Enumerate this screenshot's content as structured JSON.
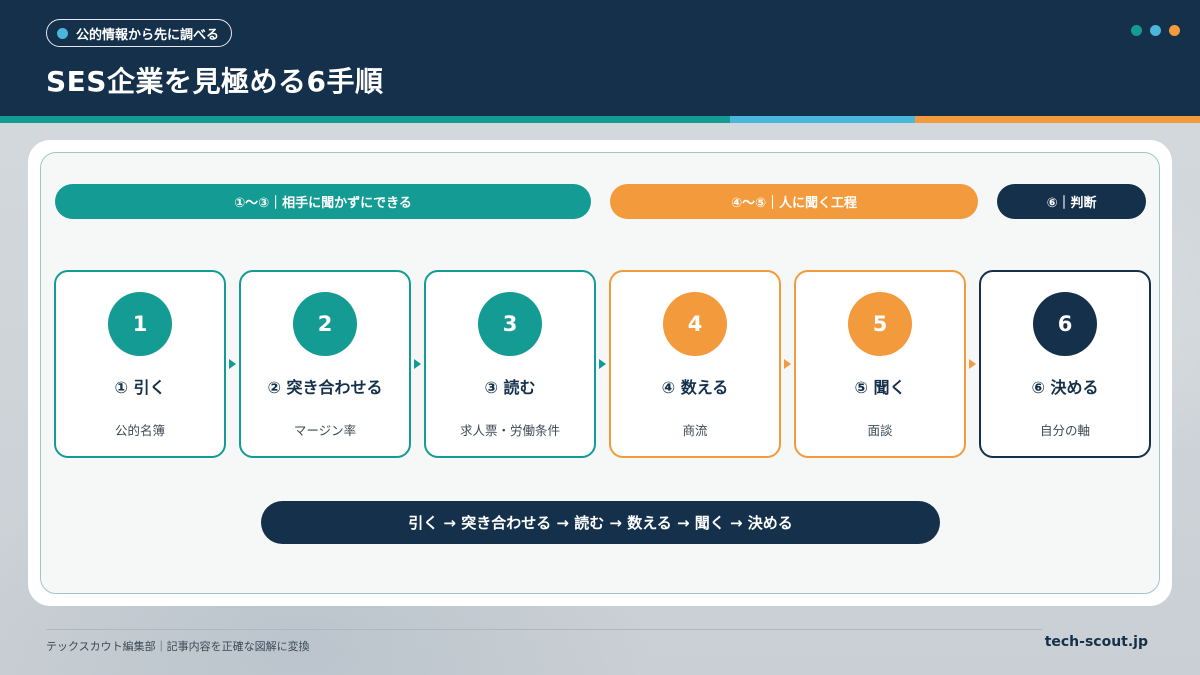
{
  "header": {
    "tag_label": "公的情報から先に調べる",
    "title": "SES企業を見極める6手順"
  },
  "colors": {
    "navy": "#14304a",
    "teal": "#149b94",
    "orange": "#f39a3c",
    "sky": "#49b6db"
  },
  "phases": [
    {
      "label": "①〜③｜相手に聞かずにできる",
      "color": "#149b94"
    },
    {
      "label": "④〜⑤｜人に聞く工程",
      "color": "#f39a3c"
    },
    {
      "label": "⑥｜判断",
      "color": "#14304a"
    }
  ],
  "steps": [
    {
      "number": "1",
      "name": "① 引く",
      "sub": "公的名簿",
      "color": "#149b94"
    },
    {
      "number": "2",
      "name": "② 突き合わせる",
      "sub": "マージン率",
      "color": "#149b94"
    },
    {
      "number": "3",
      "name": "③ 読む",
      "sub": "求人票・労働条件",
      "color": "#149b94"
    },
    {
      "number": "4",
      "name": "④ 数える",
      "sub": "商流",
      "color": "#f39a3c"
    },
    {
      "number": "5",
      "name": "⑤ 聞く",
      "sub": "面談",
      "color": "#f39a3c"
    },
    {
      "number": "6",
      "name": "⑥ 決める",
      "sub": "自分の軸",
      "color": "#14304a"
    }
  ],
  "flow_summary": "引く → 突き合わせる → 読む → 数える → 聞く → 決める",
  "footer": {
    "credit": "テックスカウト編集部｜記事内容を正確な図解に変換",
    "site": "tech-scout.jp"
  }
}
